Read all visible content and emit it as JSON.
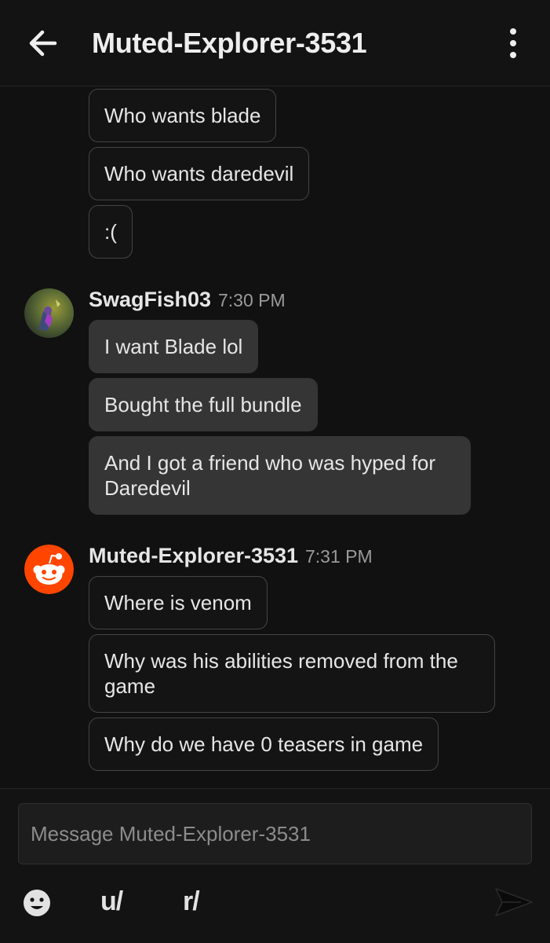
{
  "header": {
    "title": "Muted-Explorer-3531"
  },
  "messages": {
    "prev_group": {
      "bubbles": [
        "Who wants blade",
        "Who wants daredevil",
        ":("
      ]
    },
    "group1": {
      "username": "SwagFish03",
      "time": "7:30 PM",
      "bubbles": [
        "I want Blade lol",
        "Bought the full bundle",
        "And I got a friend who was hyped for Daredevil"
      ]
    },
    "group2": {
      "username": "Muted-Explorer-3531",
      "time": "7:31 PM",
      "bubbles": [
        "Where is venom",
        "Why was his abilities removed from the game",
        "Why do we have 0 teasers in game"
      ]
    }
  },
  "composer": {
    "placeholder": "Message Muted-Explorer-3531",
    "value": "",
    "user_mention_label": "u/",
    "subreddit_mention_label": "r/"
  },
  "icons": {
    "back": "arrow-left-icon",
    "menu": "vertical-dots-icon",
    "emoji": "emoji-icon",
    "send": "send-icon"
  },
  "colors": {
    "background": "#111111",
    "sent_bubble_border": "#454545",
    "received_bubble_fill": "#353535",
    "reddit_orange": "#ff4500"
  }
}
